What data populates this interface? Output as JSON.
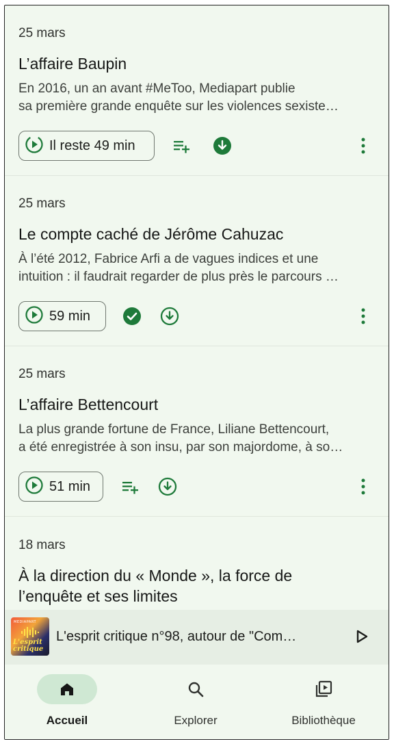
{
  "episodes": [
    {
      "date": "25 mars",
      "title": "L’affaire Baupin",
      "desc_line1": "En 2016, un an avant #MeToo, Mediapart publie",
      "desc_line2": "sa première grande enquête sur les violences sexiste…",
      "duration": "Il reste 49 min"
    },
    {
      "date": "25 mars",
      "title": "Le compte caché de Jérôme Cahuzac",
      "desc_line1": "À l’été 2012, Fabrice Arfi a de vagues indices et une",
      "desc_line2": "intuition : il faudrait regarder de plus près le parcours …",
      "duration": "59 min"
    },
    {
      "date": "25 mars",
      "title": "L’affaire Bettencourt",
      "desc_line1": "La plus grande fortune de France, Liliane Bettencourt,",
      "desc_line2": "a été enregistrée à son insu, par son majordome, à so…",
      "duration": "51 min"
    },
    {
      "date": "18 mars",
      "title_line1": "À la direction du « Monde », la force de",
      "title_line2": "l’enquête et ses limites"
    }
  ],
  "mini_player": {
    "title": "L'esprit critique n°98, autour de \"Com…",
    "cover_brand": "MEDIAPART",
    "cover_title_1": "L'esprit",
    "cover_title_2": "critique"
  },
  "nav": {
    "home": "Accueil",
    "explore": "Explorer",
    "library": "Bibliothèque"
  },
  "colors": {
    "accent": "#1e7a3a",
    "background": "#f1f8ef",
    "active_pill": "#cfe8d3"
  }
}
